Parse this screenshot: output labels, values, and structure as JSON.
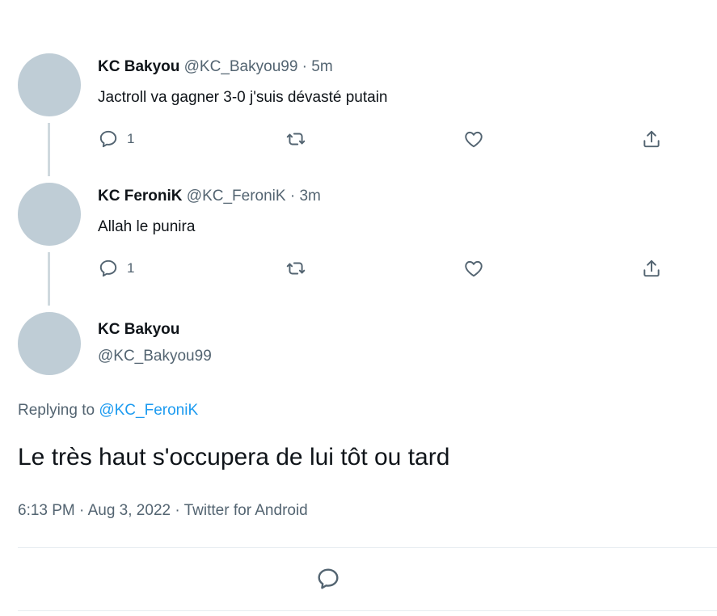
{
  "tweets": [
    {
      "display_name": "KC Bakyou",
      "meta": "@KC_Bakyou99 · 5m",
      "text": "Jactroll va gagner 3-0 j'suis dévasté putain",
      "reply_count": "1"
    },
    {
      "display_name": "KC FeroniK",
      "meta": "@KC_FeroniK · 3m",
      "text": "Allah le punira",
      "reply_count": "1"
    }
  ],
  "main_tweet": {
    "display_name": "KC Bakyou",
    "handle": "@KC_Bakyou99",
    "replying_prefix": "Replying to",
    "replying_mention": "@KC_FeroniK",
    "text": "Le très haut s'occupera de lui tôt ou tard",
    "time_date": "6:13 PM · Aug 3, 2022 · ",
    "source": "Twitter for Android"
  },
  "icons": {
    "reply": "reply-icon",
    "retweet": "retweet-icon",
    "like": "heart-icon",
    "share": "share-icon"
  },
  "colors": {
    "link": "#1d9bf0",
    "secondary_text": "#536471",
    "avatar_placeholder": "#bfcdd6"
  }
}
